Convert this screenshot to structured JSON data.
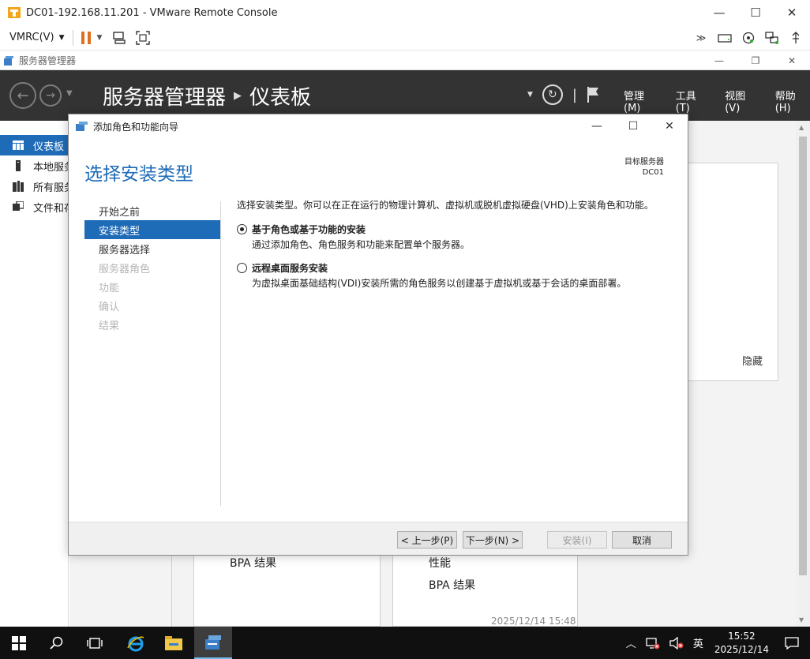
{
  "vmrc": {
    "title": "DC01-192.168.11.201 - VMware Remote Console",
    "menu_label": "VMRC(V)",
    "colors": {
      "accent": "#e07020"
    }
  },
  "server_manager": {
    "window_title": "服务器管理器",
    "breadcrumb_root": "服务器管理器",
    "breadcrumb_page": "仪表板",
    "menu": [
      "管理(M)",
      "工具(T)",
      "视图(V)",
      "帮助(H)"
    ],
    "sidebar": [
      {
        "label": "仪表板",
        "icon": "dashboard-icon",
        "active": true
      },
      {
        "label": "本地服务器",
        "icon": "server-icon",
        "active": false
      },
      {
        "label": "所有服务器",
        "icon": "servers-icon",
        "active": false
      },
      {
        "label": "文件和存储服务",
        "icon": "storage-icon",
        "active": false
      }
    ],
    "hide_label": "隐藏",
    "card_left_bpa": "BPA 结果",
    "card_right_perf": "性能",
    "card_right_bpa": "BPA 结果",
    "timestamp": "2025/12/14 15:48"
  },
  "wizard": {
    "title": "添加角色和功能向导",
    "heading": "选择安装类型",
    "target_label": "目标服务器",
    "target_value": "DC01",
    "steps": [
      {
        "label": "开始之前",
        "state": "normal"
      },
      {
        "label": "安装类型",
        "state": "active"
      },
      {
        "label": "服务器选择",
        "state": "normal"
      },
      {
        "label": "服务器角色",
        "state": "disabled"
      },
      {
        "label": "功能",
        "state": "disabled"
      },
      {
        "label": "确认",
        "state": "disabled"
      },
      {
        "label": "结果",
        "state": "disabled"
      }
    ],
    "intro": "选择安装类型。你可以在正在运行的物理计算机、虚拟机或脱机虚拟硬盘(VHD)上安装角色和功能。",
    "options": [
      {
        "title": "基于角色或基于功能的安装",
        "desc": "通过添加角色、角色服务和功能来配置单个服务器。",
        "checked": true
      },
      {
        "title": "远程桌面服务安装",
        "desc": "为虚拟桌面基础结构(VDI)安装所需的角色服务以创建基于虚拟机或基于会话的桌面部署。",
        "checked": false
      }
    ],
    "buttons": {
      "prev": "< 上一步(P)",
      "next": "下一步(N) >",
      "install": "安装(I)",
      "cancel": "取消"
    }
  },
  "taskbar": {
    "ime": "英",
    "time": "15:52",
    "date": "2025/12/14"
  }
}
